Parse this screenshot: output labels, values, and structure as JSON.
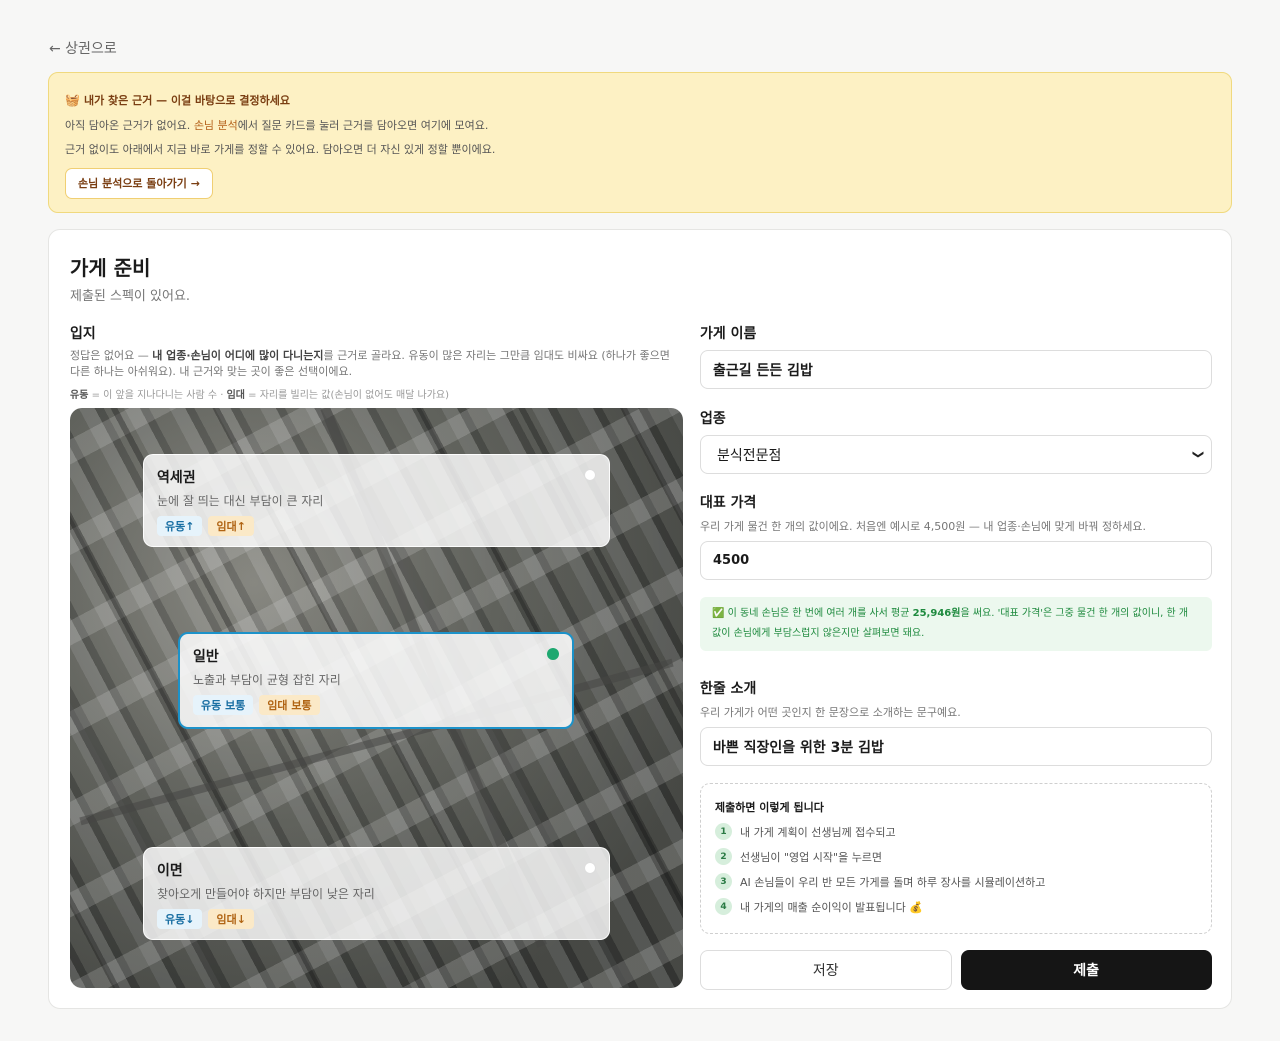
{
  "nav": {
    "back_label": "← 상권으로"
  },
  "evidence": {
    "icon": "🧺",
    "title": "내가 찾은 근거 — 이걸 바탕으로 결정하세요",
    "line1_a": "아직 담아온 근거가 없어요. ",
    "line1_link": "손님 분석",
    "line1_b": "에서 질문 카드를 눌러 근거를 담아오면 여기에 모여요.",
    "line2": "근거 없이도 아래에서 지금 바로 가게를 정할 수 있어요. 담아오면 더 자신 있게 정할 뿐이에요.",
    "button_label": "손님 분석으로 돌아가기 →"
  },
  "card": {
    "title": "가게 준비",
    "subtitle": "제출된 스펙이 있어요."
  },
  "location": {
    "label": "입지",
    "desc_a": "정답은 없어요 — ",
    "desc_bold": "내 업종·손님이 어디에 많이 다니는지",
    "desc_b": "를 근거로 골라요. 유동이 많은 자리는 그만큼 임대도 비싸요 (하나가 좋으면 다른 하나는 아쉬워요). 내 근거와 맞는 곳이 좋은 선택이에요.",
    "legend_flow_key": "유동",
    "legend_flow_text": " = 이 앞을 지나다니는 사람 수 · ",
    "legend_rent_key": "임대",
    "legend_rent_text": " = 자리를 빌리는 값(손님이 없어도 매달 나가요)",
    "zones": [
      {
        "name": "역세권",
        "desc": "눈에 잘 띄는 대신 부담이 큰 자리",
        "flow": "유동↑",
        "rent": "임대↑",
        "selected": false
      },
      {
        "name": "일반",
        "desc": "노출과 부담이 균형 잡힌 자리",
        "flow": "유동 보통",
        "rent": "임대 보통",
        "selected": true
      },
      {
        "name": "이면",
        "desc": "찾아오게 만들어야 하지만 부담이 낮은 자리",
        "flow": "유동↓",
        "rent": "임대↓",
        "selected": false
      }
    ]
  },
  "form": {
    "name_label": "가게 이름",
    "name_value": "출근길 든든 김밥",
    "category_label": "업종",
    "category_value": "분식전문점",
    "price_label": "대표 가격",
    "price_hint": "우리 가게 물건 한 개의 값이에요. 처음엔 예시로 4,500원 — 내 업종·손님에 맞게 바꿔 정하세요.",
    "price_value": "4500",
    "notice_a": "✅ 이 동네 손님은 한 번에 여러 개를 사서 평균 ",
    "notice_bold": "25,946원",
    "notice_b": "을 써요. '대표 가격'은 그중 물건 한 개의 값이니, 한 개 값이 손님에게 부담스럽지 않은지만 살펴보면 돼요.",
    "intro_label": "한줄 소개",
    "intro_hint": "우리 가게가 어떤 곳인지 한 문장으로 소개하는 문구예요.",
    "intro_value": "바쁜 직장인을 위한 3분 김밥"
  },
  "steps": {
    "title": "제출하면 이렇게 됩니다",
    "items": [
      {
        "num": "1",
        "text": "내 가게 계획이 선생님께 접수되고"
      },
      {
        "num": "2",
        "text": "선생님이 \"영업 시작\"을 누르면"
      },
      {
        "num": "3",
        "text": "AI 손님들이 우리 반 모든 가게를 돌며 하루 장사를 시뮬레이션하고"
      },
      {
        "num": "4",
        "text": "내 가게의 매출 순이익이 발표됩니다 💰"
      }
    ]
  },
  "actions": {
    "save_label": "저장",
    "submit_label": "제출"
  },
  "colors": {
    "accent_blue": "#1c92c9",
    "selected_dot": "#1ea870",
    "submit_bg": "#151515",
    "evidence_bg": "#fdf1c4"
  }
}
